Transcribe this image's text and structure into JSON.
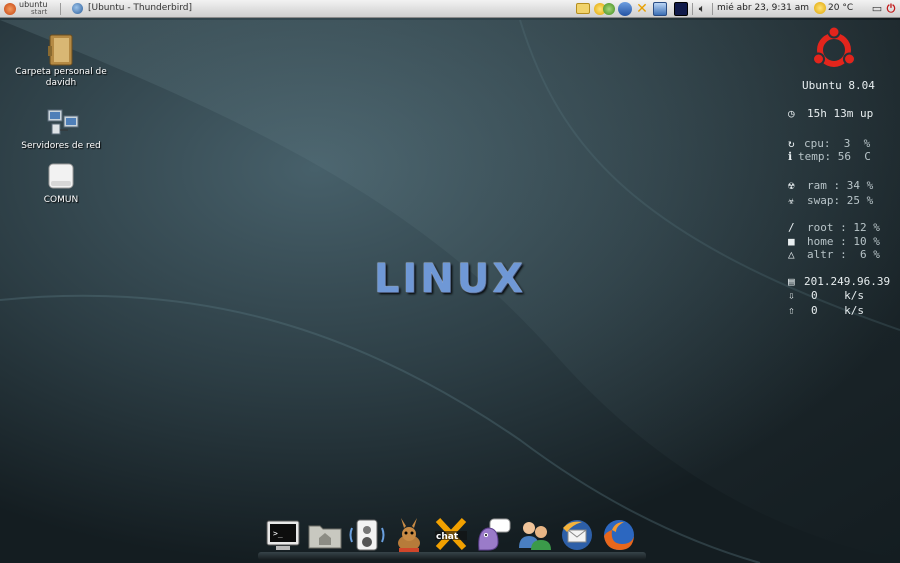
{
  "topbar": {
    "start_brand": "ubuntu",
    "start_label": "start",
    "task_title": "[Ubuntu - Thunderbird]",
    "clock": "mié abr 23, 9:31 am",
    "temperature": "20 °C",
    "tray_icons": [
      "mail-icon",
      "network-status-icon",
      "bluetooth-icon",
      "xchat-icon",
      "network-manager-icon",
      "terminal-status-icon",
      "volume-icon"
    ]
  },
  "desktop_icons": [
    {
      "name": "home-folder",
      "label": "Carpeta personal de davidh"
    },
    {
      "name": "network-servers",
      "label": "Servidores de red"
    },
    {
      "name": "comun-drive",
      "label": "COMUN"
    }
  ],
  "center_title": "LINUX",
  "conky": {
    "os": "Ubuntu 8.04",
    "uptime": "15h 13m up",
    "cpu": "cpu:  3  %",
    "temp": "temp: 56  C",
    "ram": "ram : 34 %",
    "swap": "swap: 25 %",
    "root": "root : 12 %",
    "home": "home : 10 %",
    "altr": "altr :  6 %",
    "ip": "201.249.96.39",
    "down": "0    k/s",
    "up": "0    k/s",
    "root_symbol": "/"
  },
  "dock": [
    "terminal",
    "home-folder",
    "audio-player",
    "amule",
    "xchat",
    "pidgin",
    "contacts",
    "thunderbird",
    "firefox"
  ],
  "colors": {
    "accent": "#e3251c",
    "wallpaper": "#2c3d44",
    "linux_text": "#6f98d6"
  }
}
